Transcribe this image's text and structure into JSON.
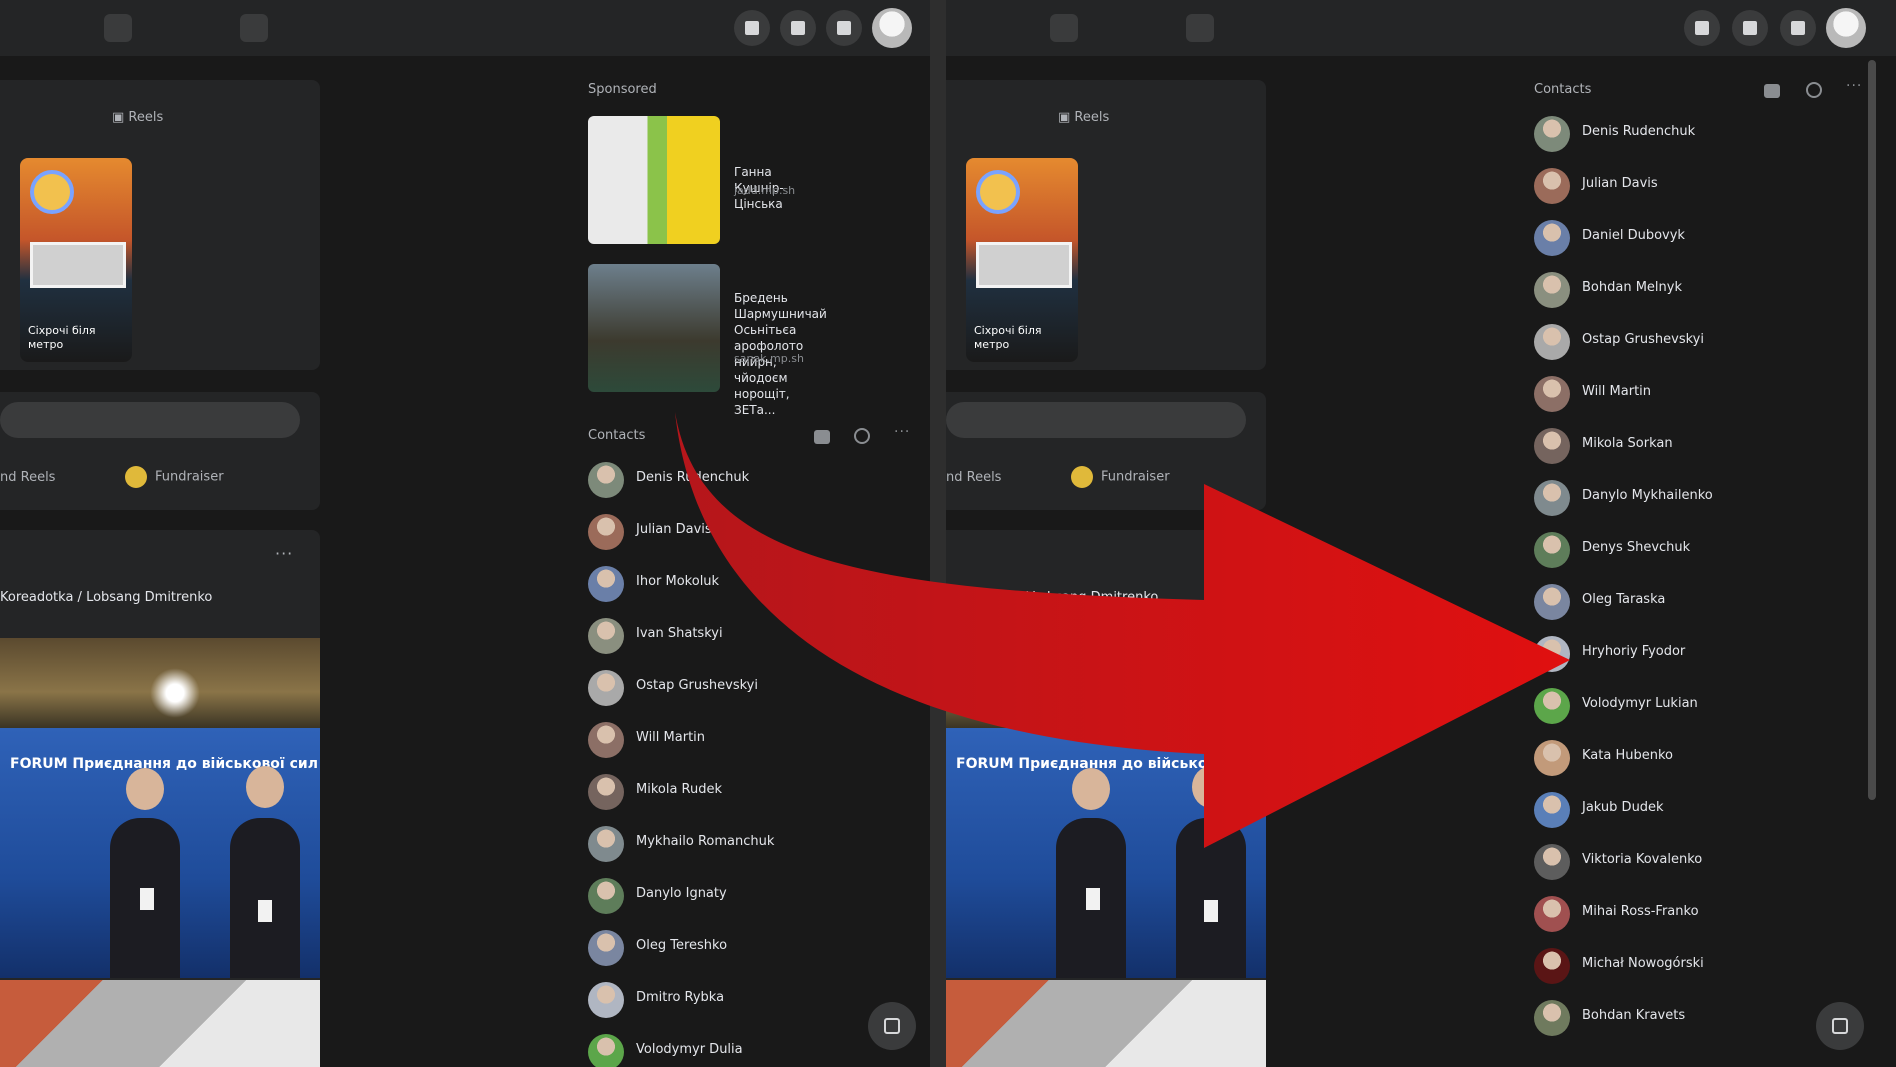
{
  "left": {
    "stories_label": "Reels",
    "story_caption": "Сіхрочі біля\nметро",
    "chips": [
      "nd Reels",
      "Fundraiser"
    ],
    "post_title": "Koreadotka / Lobsang Dmitrenko",
    "banner_text": "FORUM Приєднання до військової сил",
    "sponsored_label": "Sponsored",
    "sponsored": [
      {
        "title": "Ганна Кушнір-Цінська",
        "sub": "jadd.mp.sh"
      },
      {
        "title": "Бредень Шармушничай Осьнітьєа\nарофолото нийрн, чйодоєм\nнорощіт, ЗЕТа...",
        "sub": "sanak.mp.sh"
      }
    ],
    "contacts_label": "Contacts",
    "contacts": [
      "Denis Rudenchuk",
      "Julian Davis",
      "Ihor Mokoluk",
      "Ivan Shatskyi",
      "Ostap Grushevskyi",
      "Will Martin",
      "Mikola Rudek",
      "Mykhailo Romanchuk",
      "Danylo Ignaty",
      "Oleg Tereshko",
      "Dmitro Rybka",
      "Volodymyr Dulia"
    ]
  },
  "right": {
    "stories_label": "Reels",
    "story_caption": "Сіхрочі біля\nметро",
    "chips": [
      "nd Reels",
      "Fundraiser"
    ],
    "post_title": "Koreadotka / Lobsang Dmitrenko",
    "banner_text": "FORUM Приєднання до військової сил",
    "contacts_label": "Contacts",
    "contacts": [
      "Denis Rudenchuk",
      "Julian Davis",
      "Daniel Dubovyk",
      "Bohdan Melnyk",
      "Ostap Grushevskyi",
      "Will Martin",
      "Mikola Sorkan",
      "Danylo Mykhailenko",
      "Denys Shevchuk",
      "Oleg Taraska",
      "Hryhoriy Fyodor",
      "Volodymyr Lukian",
      "Kata Hubenko",
      "Jakub Dudek",
      "Viktoria Kovalenko",
      "Mihai Ross-Franko",
      "Michał Nowogórski",
      "Bohdan Kravets"
    ]
  },
  "arrow_color": "#e01010",
  "theme": {
    "bg": "#191919",
    "card": "#242526",
    "accent_green": "#4caf50"
  }
}
